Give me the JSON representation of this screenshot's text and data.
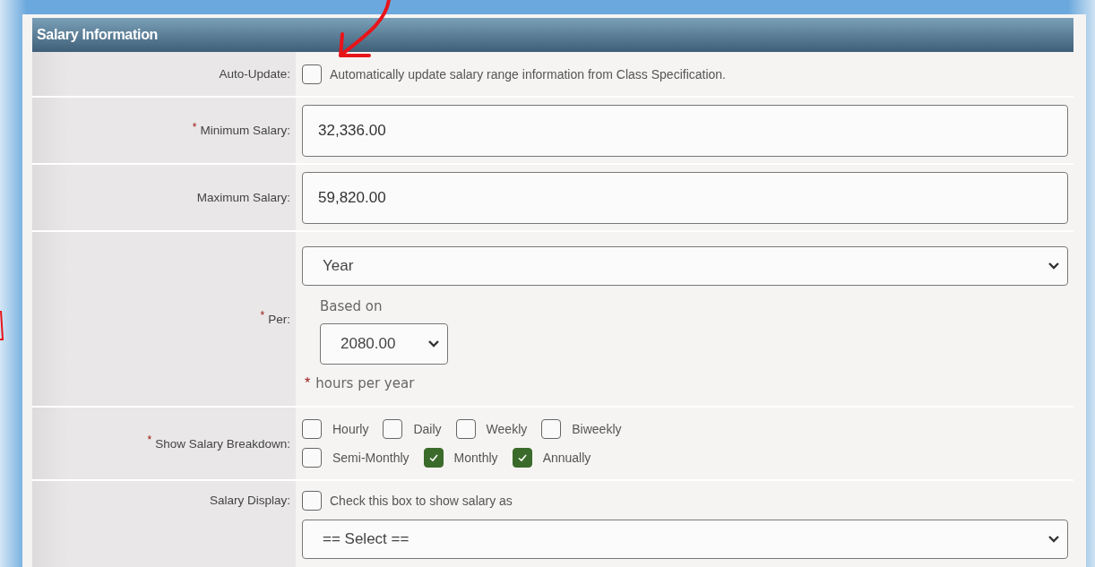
{
  "panel": {
    "title": "Salary Information"
  },
  "rows": [
    {
      "kind": "checkbox",
      "label": "Auto-Update:",
      "checkbox": {
        "label": "Automatically update salary range information from Class Specification.",
        "checked": false
      }
    },
    {
      "kind": "input",
      "label": "Minimum Salary:",
      "required_mark": "*",
      "value": "32,336.00"
    },
    {
      "kind": "input",
      "label": "Maximum Salary:",
      "value": "59,820.00"
    },
    {
      "kind": "per",
      "label": "Per:",
      "required_mark": "*",
      "select": {
        "value": "Year"
      },
      "based_on_label": "Based on",
      "based_on": {
        "value": "2080.00"
      },
      "hours_mark": "*",
      "hours_label": "hours per year"
    },
    {
      "kind": "options",
      "label": "Show Salary Breakdown:",
      "required_mark": "*",
      "lines": [
        [
          {
            "label": "Hourly",
            "checked": false
          },
          {
            "label": "Daily",
            "checked": false
          },
          {
            "label": "Weekly",
            "checked": false
          },
          {
            "label": "Biweekly",
            "checked": false
          }
        ],
        [
          {
            "label": "Semi-Monthly",
            "checked": false
          },
          {
            "label": "Monthly",
            "checked": true
          },
          {
            "label": "Annually",
            "checked": true
          }
        ]
      ]
    },
    {
      "kind": "display",
      "label": "Salary Display:",
      "checkbox": {
        "label": "Check this box to show salary as",
        "checked": false
      },
      "select": {
        "value": "== Select =="
      }
    }
  ]
}
